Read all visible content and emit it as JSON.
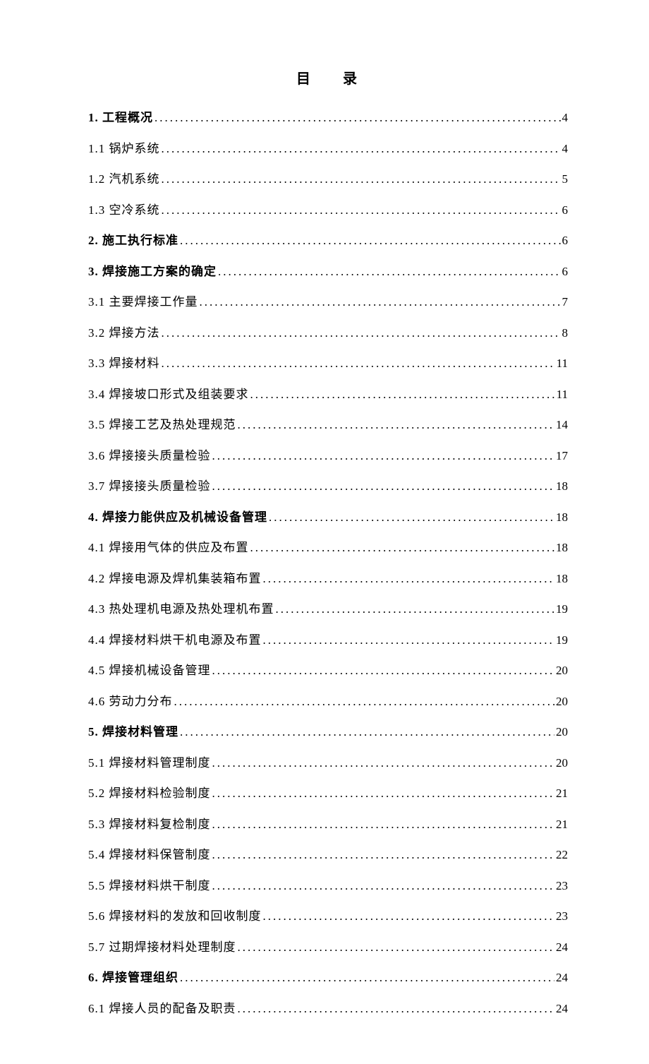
{
  "title_left": "目",
  "title_right": "录",
  "entries": [
    {
      "label": "1. 工程概况",
      "page": "4",
      "bold": true
    },
    {
      "label": "1.1 锅炉系统",
      "page": "4",
      "bold": false
    },
    {
      "label": "1.2 汽机系统",
      "page": "5",
      "bold": false
    },
    {
      "label": "1.3 空冷系统",
      "page": "6",
      "bold": false
    },
    {
      "label": "2. 施工执行标准",
      "page": "6",
      "bold": true
    },
    {
      "label": "3. 焊接施工方案的确定",
      "page": "6",
      "bold": true
    },
    {
      "label": "3.1 主要焊接工作量",
      "page": "7",
      "bold": false
    },
    {
      "label": "3.2 焊接方法",
      "page": "8",
      "bold": false
    },
    {
      "label": "3.3 焊接材料",
      "page": "11",
      "bold": false
    },
    {
      "label": "3.4 焊接坡口形式及组装要求",
      "page": "11",
      "bold": false
    },
    {
      "label": "3.5 焊接工艺及热处理规范",
      "page": "14",
      "bold": false
    },
    {
      "label": "3.6 焊接接头质量检验",
      "page": "17",
      "bold": false
    },
    {
      "label": "3.7 焊接接头质量检验",
      "page": "18",
      "bold": false
    },
    {
      "label": "4. 焊接力能供应及机械设备管理",
      "page": "18",
      "bold": true
    },
    {
      "label": "4.1 焊接用气体的供应及布置",
      "page": "18",
      "bold": false
    },
    {
      "label": "4.2 焊接电源及焊机集装箱布置",
      "page": "18",
      "bold": false
    },
    {
      "label": "4.3 热处理机电源及热处理机布置",
      "page": "19",
      "bold": false
    },
    {
      "label": "4.4 焊接材料烘干机电源及布置",
      "page": "19",
      "bold": false
    },
    {
      "label": "4.5 焊接机械设备管理",
      "page": "20",
      "bold": false
    },
    {
      "label": "4.6 劳动力分布",
      "page": "20",
      "bold": false
    },
    {
      "label": "5. 焊接材料管理 ",
      "page": "20",
      "bold": true
    },
    {
      "label": "5.1 焊接材料管理制度",
      "page": "20",
      "bold": false
    },
    {
      "label": "5.2 焊接材料检验制度",
      "page": "21",
      "bold": false
    },
    {
      "label": "5.3 焊接材料复检制度",
      "page": "21",
      "bold": false
    },
    {
      "label": "5.4 焊接材料保管制度",
      "page": "22",
      "bold": false
    },
    {
      "label": "5.5 焊接材料烘干制度",
      "page": "23",
      "bold": false
    },
    {
      "label": "5.6 焊接材料的发放和回收制度",
      "page": "23",
      "bold": false
    },
    {
      "label": "5.7 过期焊接材料处理制度",
      "page": "24",
      "bold": false
    },
    {
      "label": "6. 焊接管理组织 ",
      "page": "24",
      "bold": true
    },
    {
      "label": "6.1 焊接人员的配备及职责",
      "page": "24",
      "bold": false
    }
  ]
}
